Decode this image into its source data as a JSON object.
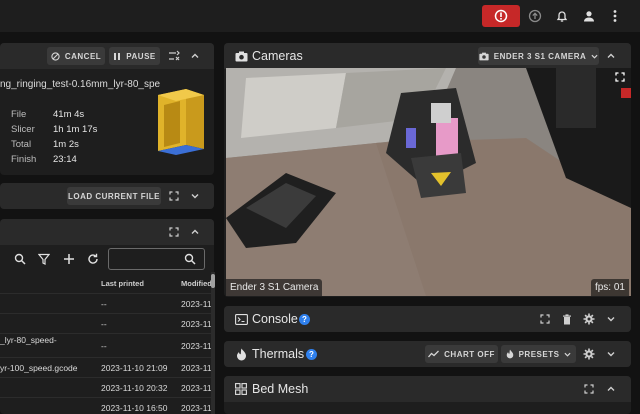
{
  "appbar": {
    "icons": [
      "emergency-stop-icon",
      "upload-icon",
      "bell-icon",
      "account-icon",
      "more-vertical-icon"
    ]
  },
  "status": {
    "cancel_label": "CANCEL",
    "pause_label": "PAUSE",
    "filename": "ng_ringing_test-0.16mm_lyr-80_spe",
    "stats": [
      {
        "key": "File",
        "value": "41m 4s"
      },
      {
        "key": "Slicer",
        "value": "1h 1m 17s"
      },
      {
        "key": "Total",
        "value": "1m 2s"
      },
      {
        "key": "Finish",
        "value": "23:14"
      }
    ],
    "thumbnail_color": "#e0b32a"
  },
  "load_file": {
    "button_label": "LOAD CURRENT FILE"
  },
  "jobs": {
    "search_value": "",
    "columns": [
      "Last printed",
      "Modified"
    ],
    "rows": [
      {
        "name": "",
        "last_printed": "--",
        "modified": "2023-11"
      },
      {
        "name": "",
        "last_printed": "--",
        "modified": "2023-11"
      },
      {
        "name": "_lyr-80_speed-",
        "last_printed": "--",
        "modified": "2023-11"
      },
      {
        "name": "yr-100_speed.gcode",
        "last_printed": "2023-11-10 21:09",
        "modified": "2023-11"
      },
      {
        "name": "",
        "last_printed": "2023-11-10 20:32",
        "modified": "2023-11"
      },
      {
        "name": "",
        "last_printed": "2023-11-10 16:50",
        "modified": "2023-11"
      }
    ]
  },
  "cameras": {
    "title": "Cameras",
    "selector_label": "ENDER 3 S1 CAMERA",
    "camera_name": "Ender 3 S1 Camera",
    "fps_text": "fps: 01"
  },
  "console": {
    "title": "Console"
  },
  "thermals": {
    "title": "Thermals",
    "chart_off_label": "CHART OFF",
    "presets_label": "PRESETS"
  },
  "bed_mesh": {
    "title": "Bed Mesh"
  },
  "colors": {
    "background": "#121212",
    "card": "#1e1e1e",
    "card_header": "#2a2a2a",
    "emergency": "#c62828",
    "help_badge": "#2f80ed"
  }
}
